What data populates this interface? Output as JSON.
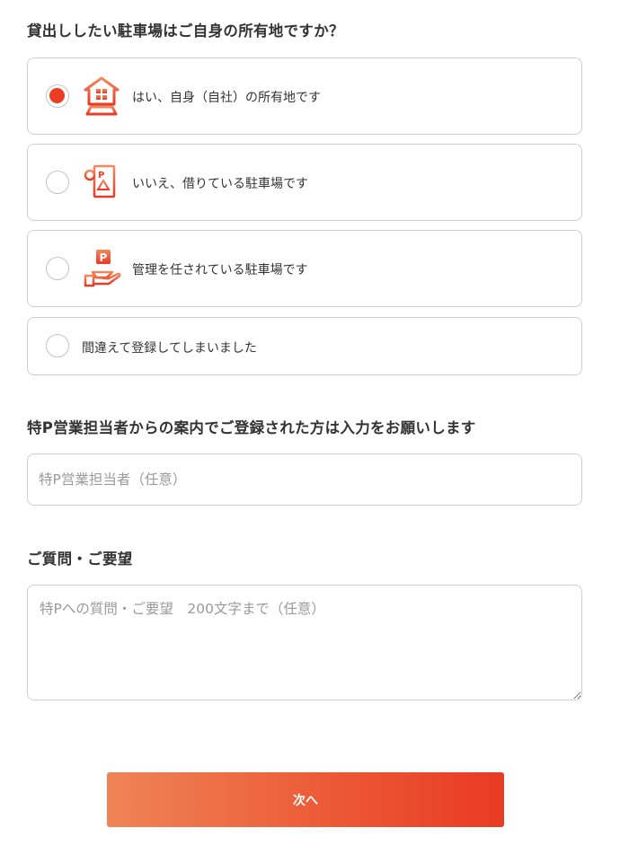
{
  "colors": {
    "accent": "#ea3d22",
    "button_gradient_start": "#ef8457",
    "button_gradient_end": "#e93a24",
    "border": "#cfcfcf",
    "text": "#333333",
    "placeholder": "#9a9a9a"
  },
  "ownership_question": {
    "title": "貸出ししたい駐車場はご自身の所有地ですか？",
    "options": [
      {
        "label": "はい、自身（自社）の所有地です",
        "icon": "house-icon",
        "selected": true
      },
      {
        "label": "いいえ、借りている駐車場です",
        "icon": "parking-document-icon",
        "selected": false
      },
      {
        "label": "管理を任されている駐車場です",
        "icon": "parking-hand-icon",
        "selected": false
      },
      {
        "label": "間違えて登録してしまいました",
        "icon": null,
        "selected": false
      }
    ]
  },
  "sales_rep": {
    "title": "特P営業担当者からの案内でご登録された方は入力をお願いします",
    "placeholder": "特P営業担当者（任意）",
    "value": ""
  },
  "inquiry": {
    "title": "ご質問・ご要望",
    "placeholder": "特Pへの質問・ご要望　200文字まで（任意）",
    "value": ""
  },
  "next_button": {
    "label": "次へ"
  }
}
